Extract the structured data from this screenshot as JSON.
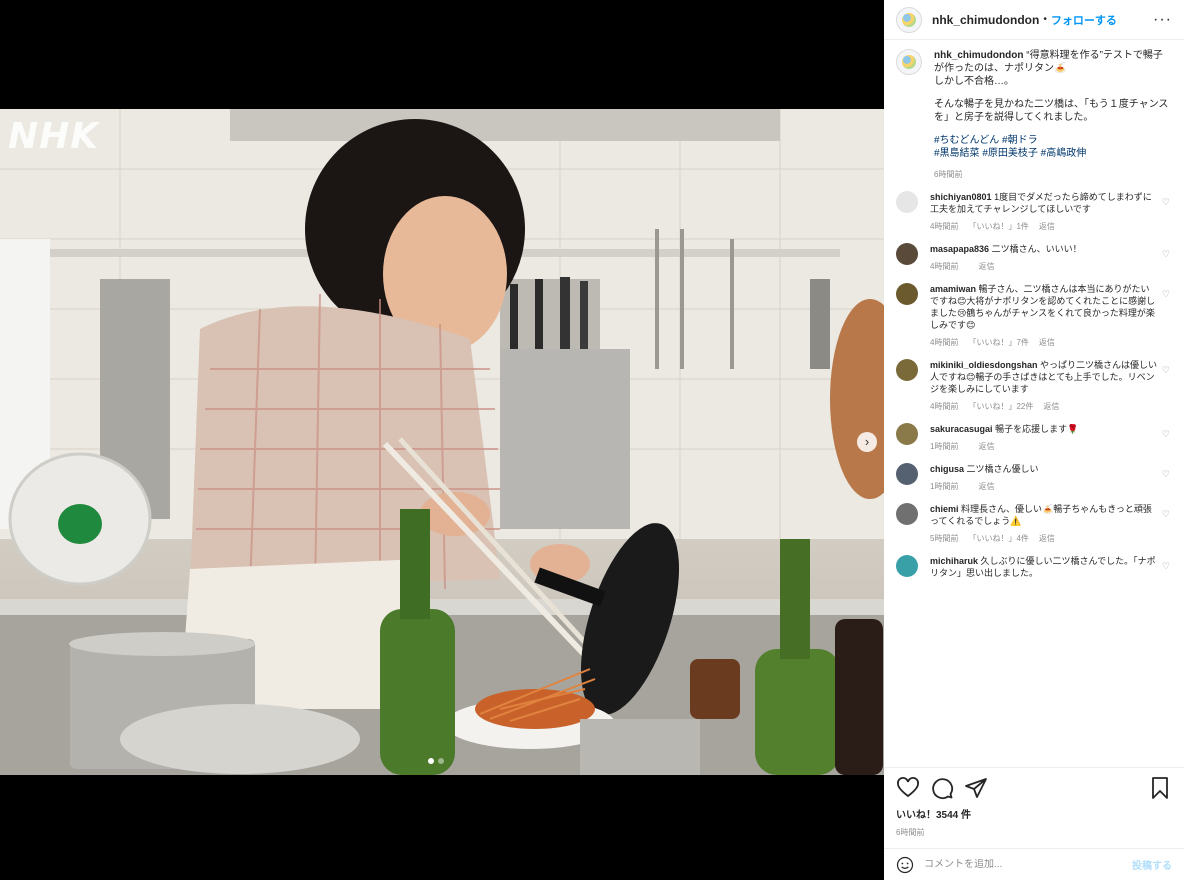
{
  "media": {
    "watermark": "NHK",
    "next_glyph": "›",
    "carousel_dots": [
      true,
      false
    ]
  },
  "header": {
    "username": "nhk_chimudondon",
    "separator": "•",
    "follow_label": "フォローする",
    "more_glyph": "···"
  },
  "caption": {
    "username": "nhk_chimudondon",
    "line1": "“得意料理を作る”テストで暢子が作ったのは、ナポリタン🍝",
    "line2": "しかし不合格…。",
    "line3": "そんな暢子を見かねた二ツ橋は、「もう１度チャンスを」と房子を説得してくれました。",
    "hashtags_1": "#ちむどんどん #朝ドラ",
    "hashtags_2": "#黒島結菜 #原田美枝子 #高嶋政伸",
    "time": "6時間前"
  },
  "comments": [
    {
      "user": "shichiyan0801",
      "text": "1度目でダメだったら諦めてしまわずに工夫を加えてチャレンジしてほしいです",
      "time": "4時間前",
      "likes": "「いいね！」1件",
      "reply": "返信",
      "avatar_color": "#e6e6e6"
    },
    {
      "user": "masapapa836",
      "text": "二ツ橋さん、いいい！",
      "time": "4時間前",
      "likes": "",
      "reply": "返信",
      "avatar_color": "#5a4a3a"
    },
    {
      "user": "amamiwan",
      "text": "暢子さん、二ツ橋さんは本当にありがたいですね😊大将がナポリタンを認めてくれたことに感謝しました😢鶴ちゃんがチャンスをくれて良かった料理が楽しみです😊",
      "time": "4時間前",
      "likes": "「いいね！」7件",
      "reply": "返信",
      "avatar_color": "#6b5a2e"
    },
    {
      "user": "mikiniki_oldiesdongshan",
      "text": "やっぱり二ツ橋さんは優しい人ですね😊暢子の手さばきはとても上手でした。リベンジを楽しみにしています",
      "time": "4時間前",
      "likes": "「いいね！」22件",
      "reply": "返信",
      "avatar_color": "#7a6a3a"
    },
    {
      "user": "sakuracasugai",
      "text": "暢子を応援します🌹",
      "time": "1時間前",
      "likes": "",
      "reply": "返信",
      "avatar_color": "#8a7a4a"
    },
    {
      "user": "chigusa",
      "text": "二ツ橋さん優しい",
      "time": "1時間前",
      "likes": "",
      "reply": "返信",
      "avatar_color": "#556070"
    },
    {
      "user": "chiemi",
      "text": "料理長さん、優しい🍝暢子ちゃんもきっと頑張ってくれるでしょう⚠️",
      "time": "5時間前",
      "likes": "「いいね！」4件",
      "reply": "返信",
      "avatar_color": "#707070"
    },
    {
      "user": "michiharuk",
      "text": "久しぶりに優しい二ツ橋さんでした。「ナポリタン」思い出しました。",
      "time": "",
      "likes": "",
      "reply": "",
      "avatar_color": "#3aa0a8"
    }
  ],
  "actions": {
    "likes_text": "いいね！3544 件",
    "post_time": "6時間前"
  },
  "comment_box": {
    "placeholder": "コメントを追加...",
    "post_label": "投稿する"
  }
}
